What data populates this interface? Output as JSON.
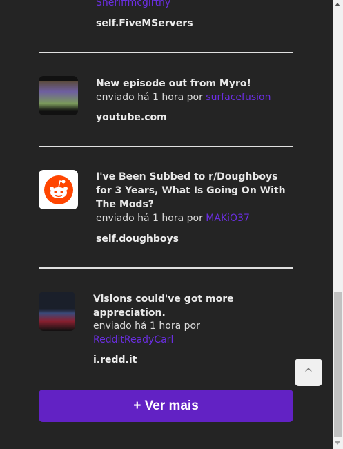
{
  "posts": [
    {
      "author": "Sheriffmcgirthy",
      "domain": "self.FiveMServers"
    },
    {
      "title": "New episode out from Myro!",
      "meta": "enviado há 1 hora por",
      "author": "surfacefusion",
      "domain": "youtube.com",
      "thumb": "minecraft-video-thumbnail"
    },
    {
      "title_lines": [
        "I've Been Subbed to r/Doughboys",
        "for 3 Years, What Is Going On With",
        "The Mods?"
      ],
      "meta": "enviado há 1 hora por",
      "author": "MAKiO37",
      "domain": "self.doughboys",
      "thumb": "reddit-logo"
    },
    {
      "title_lines": [
        "Visions could've got more",
        "appreciation."
      ],
      "meta": "enviado há 1 hora por",
      "author": "RedditReadyCarl",
      "domain": "i.redd.it",
      "thumb": "screenshot-thumbnail"
    }
  ],
  "load_more_label": "+ Ver mais",
  "scroll_top_label": "^",
  "colors": {
    "background": "#242424",
    "accent": "#6222c4",
    "link": "#6a2ee0"
  }
}
